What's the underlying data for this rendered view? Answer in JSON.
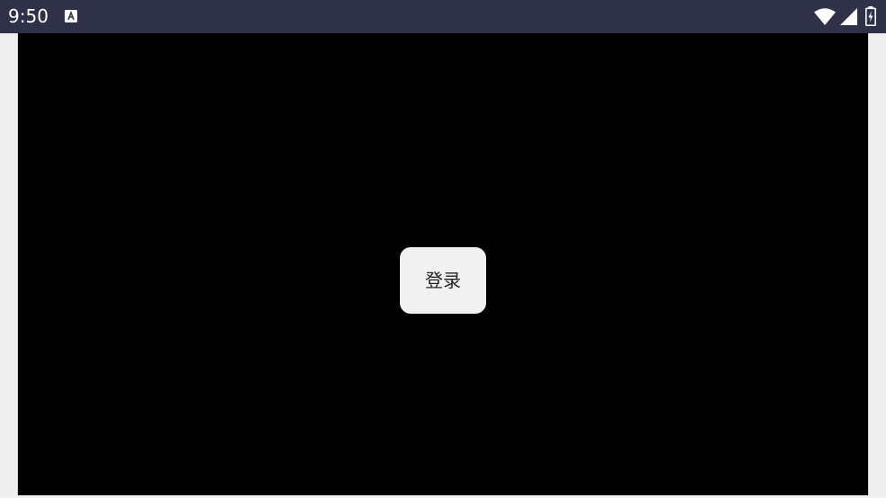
{
  "status_bar": {
    "time": "9:50",
    "notification_icon": "a-notification-icon",
    "icons": [
      "wifi-icon",
      "cellular-signal-icon",
      "battery-charging-icon"
    ],
    "background_color": "#2e3147"
  },
  "webview": {
    "background_color": "#000000",
    "login_button": {
      "label": "登录"
    }
  }
}
